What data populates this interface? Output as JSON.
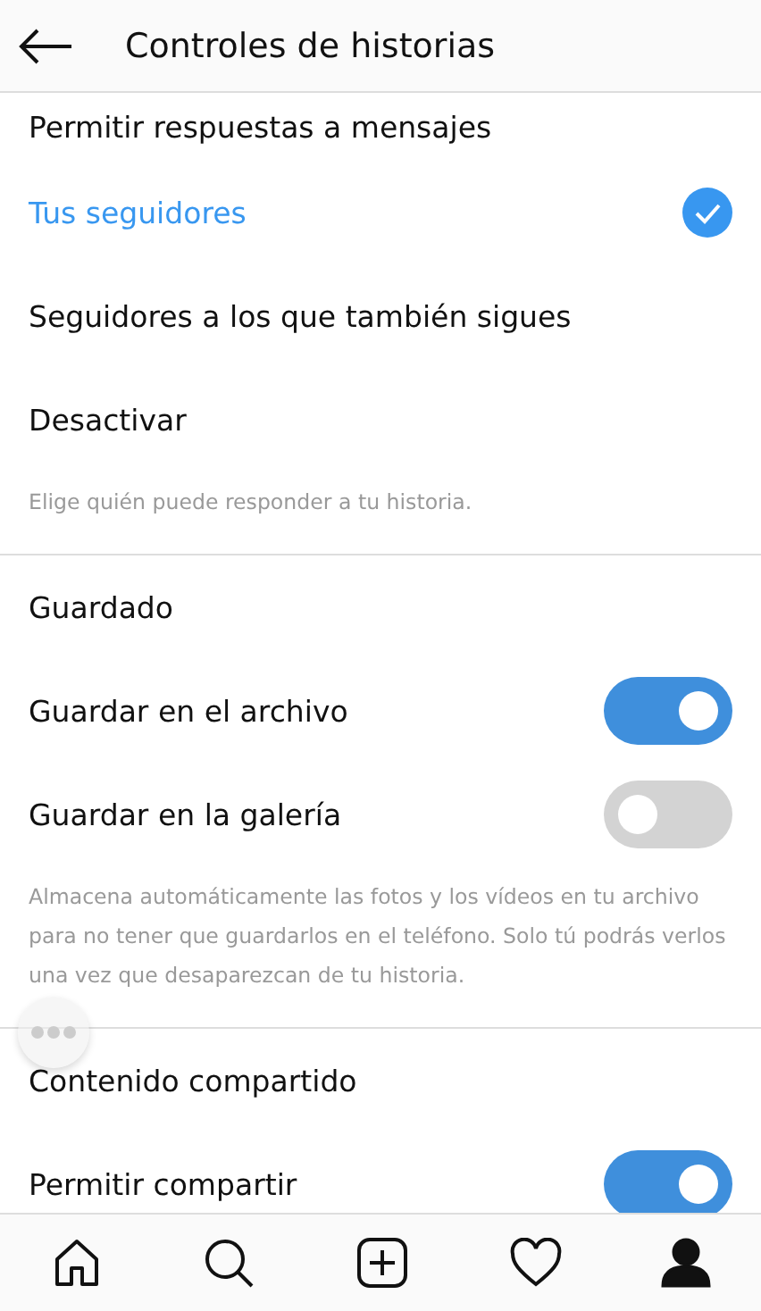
{
  "header": {
    "title": "Controles de historias"
  },
  "sections": [
    {
      "title": "Permitir respuestas a mensajes",
      "items": [
        {
          "kind": "radio",
          "label": "Tus seguidores",
          "selected": true
        },
        {
          "kind": "radio",
          "label": "Seguidores a los que también sigues",
          "selected": false
        },
        {
          "kind": "radio",
          "label": "Desactivar",
          "selected": false
        }
      ],
      "note": "Elige quién puede responder a tu historia."
    },
    {
      "title": "Guardado",
      "items": [
        {
          "kind": "toggle",
          "label": "Guardar en el archivo",
          "on": true
        },
        {
          "kind": "toggle",
          "label": "Guardar en la galería",
          "on": false
        }
      ],
      "note": "Almacena automáticamente las fotos y los vídeos en tu archivo para no tener que guardarlos en el teléfono. Solo tú podrás verlos una vez que desaparezcan de tu historia."
    },
    {
      "title": "Contenido compartido",
      "items": [
        {
          "kind": "toggle",
          "label": "Permitir compartir",
          "on": true
        }
      ]
    }
  ],
  "nav": [
    {
      "kind": "home",
      "selected": false
    },
    {
      "kind": "search",
      "selected": false
    },
    {
      "kind": "add",
      "selected": false
    },
    {
      "kind": "heart",
      "selected": false
    },
    {
      "kind": "profile",
      "selected": true
    }
  ]
}
